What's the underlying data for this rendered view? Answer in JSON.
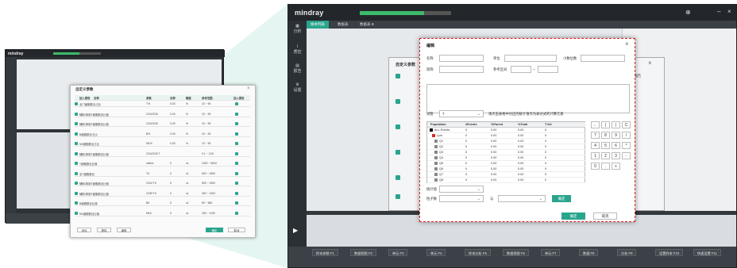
{
  "small_screen": {
    "logo": "mindray",
    "progress": 0.55,
    "dialog_title": "自定义参数",
    "table_header": [
      "加入报告",
      "名称",
      "参数",
      "名称",
      "精度",
      "参考范围",
      "加入报告"
    ],
    "rows": [
      [
        "全门细胞数目占比",
        "T%",
        "0.00",
        "%",
        "10 ~ 90"
      ],
      [
        "辅助/抑制T细胞数目比值",
        "CD4/CD8",
        "0.00",
        "%",
        "10 ~ 90"
      ],
      [
        "辅助/抑制T细胞数目比值",
        "CD4/CD8",
        "0.00",
        "%",
        "10 ~ 90"
      ],
      [
        "B细胞数目占比",
        "B%",
        "0.00",
        "%",
        "10 ~ 90"
      ],
      [
        "NK细胞数目占比",
        "NK%",
        "0.00",
        "%",
        "10 ~ 90"
      ],
      [
        "辅助/抑制T细胞数目比值",
        "CD4/CD8 T",
        "",
        "",
        "0.1 ~ 2.00"
      ],
      [
        "T细胞数目比值",
        "cell/uL",
        "0",
        "uL",
        "1000 ~ 5000"
      ],
      [
        "全T细胞数目",
        "T#",
        "0",
        "uL",
        "500 ~ 1500"
      ],
      [
        "辅助/抑制T细胞数目比值",
        "CD4+T#",
        "0",
        "uL",
        "500 ~ 1500"
      ],
      [
        "辅助/抑制T细胞数目比值",
        "CD8+T#",
        "0",
        "uL",
        "300 ~ 1200"
      ],
      [
        "B细胞数目比值",
        "B#",
        "0",
        "uL",
        "90 ~ 560"
      ],
      [
        "NK细胞数目比值",
        "NK#",
        "0",
        "uL",
        "150 ~ 1100"
      ]
    ],
    "buttons": [
      "添加",
      "删除",
      "编辑",
      "确定",
      "取消"
    ]
  },
  "big_screen": {
    "logo": "mindray",
    "progress": 0.7,
    "sidebar": [
      "分析",
      "质控",
      "报告",
      "设置"
    ],
    "tabs": [
      "样本列表",
      "数据表",
      "数据表 B"
    ],
    "status_buttons": [
      "样本参数 F1",
      "数据视图 F2",
      "单元 F3",
      "单元 F4",
      "样本分析 F5",
      "数据视图 F6",
      "单元 F7",
      "数据 F8",
      "分析 F9",
      "设置样本 F10",
      "快速设置 F11"
    ],
    "bg_dialog_title": "自定义参数",
    "bg_dialog_right": "加入报告"
  },
  "edit_dialog": {
    "title": "编辑",
    "name_label": "名称",
    "unit_label": "单位",
    "decimals_label": "小数位数",
    "abbr_label": "简称",
    "ref_label": "参考区间",
    "ref_sep": "~",
    "tube_label": "试管",
    "tube_value": "T",
    "hint": "请点击表格中对应的统计值作为表达式的计算元素",
    "grid_headers": [
      "Population",
      "#Events",
      "%Parent",
      "%Total",
      "T.Vol"
    ],
    "grid_rows": [
      {
        "name": "ALL Events",
        "events": "0",
        "parent": "0.00",
        "total": "0.00",
        "tvol": "0",
        "color": "#000000"
      },
      {
        "name": "Lym",
        "events": "0",
        "parent": "0.00",
        "total": "0.00",
        "tvol": "0",
        "color": "#d42a2a"
      },
      {
        "name": "Q1",
        "events": "0",
        "parent": "0.00",
        "total": "0.00",
        "tvol": "0",
        "color": "#888888"
      },
      {
        "name": "Q2",
        "events": "0",
        "parent": "0.00",
        "total": "0.00",
        "tvol": "0",
        "color": "#888888"
      },
      {
        "name": "Q3",
        "events": "0",
        "parent": "0.00",
        "total": "0.00",
        "tvol": "0",
        "color": "#888888"
      },
      {
        "name": "Q4",
        "events": "0",
        "parent": "0.00",
        "total": "0.00",
        "tvol": "0",
        "color": "#888888"
      },
      {
        "name": "Q5",
        "events": "0",
        "parent": "0.00",
        "total": "0.00",
        "tvol": "0",
        "color": "#888888"
      },
      {
        "name": "Q6",
        "events": "0",
        "parent": "0.00",
        "total": "0.00",
        "tvol": "0",
        "color": "#888888"
      },
      {
        "name": "Q7",
        "events": "0",
        "parent": "0.00",
        "total": "0.00",
        "tvol": "0",
        "color": "#888888"
      },
      {
        "name": "Q8",
        "events": "0",
        "parent": "0.00",
        "total": "0.00",
        "tvol": "0",
        "color": "#888888"
      }
    ],
    "keypad": [
      "←",
      "(",
      ")",
      "C",
      "7",
      "8",
      "9",
      "/",
      "4",
      "5",
      "6",
      "*",
      "1",
      "2",
      "3",
      "-",
      "0",
      ".",
      "+"
    ],
    "stat_label": "统计值",
    "tube2_label": "粒子数",
    "with_label": "与",
    "confirm_small": "确定",
    "ok": "确定",
    "cancel": "取消"
  },
  "colors": {
    "accent": "#2aa58d",
    "dark": "#33383d"
  }
}
